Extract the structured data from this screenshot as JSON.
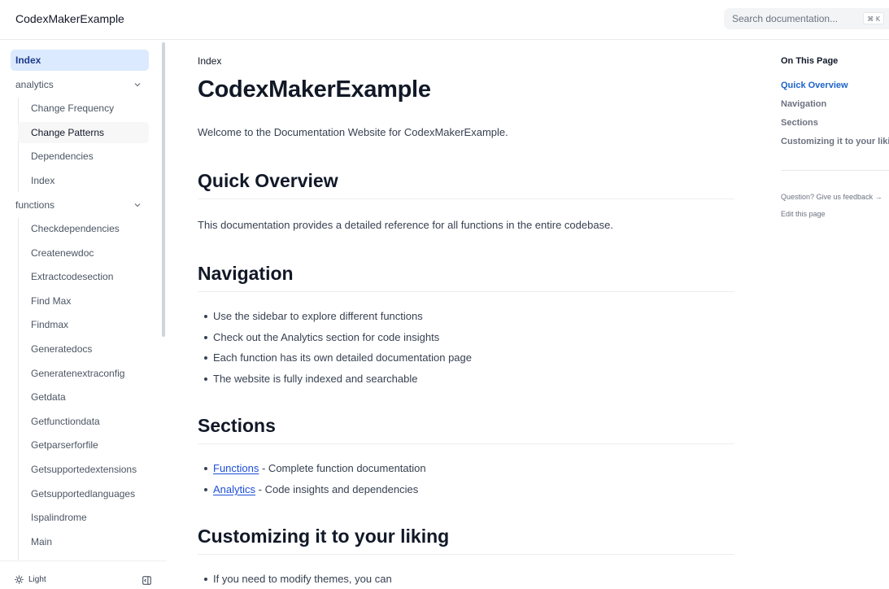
{
  "header": {
    "logo": "CodexMakerExample",
    "search_placeholder": "Search documentation...",
    "search_shortcut": "⌘ K"
  },
  "sidebar": {
    "index": "Index",
    "groups": [
      {
        "label": "analytics",
        "items": [
          "Change Frequency",
          "Change Patterns",
          "Dependencies",
          "Index"
        ]
      },
      {
        "label": "functions",
        "items": [
          "Checkdependencies",
          "Createnewdoc",
          "Extractcodesection",
          "Find Max",
          "Findmax",
          "Generatedocs",
          "Generatenextraconfig",
          "Getdata",
          "Getfunctiondata",
          "Getparserforfile",
          "Getsupportedextensions",
          "Getsupportedlanguages",
          "Ispalindrome",
          "Main"
        ]
      }
    ],
    "theme_label": "Light"
  },
  "main": {
    "breadcrumb": "Index",
    "title": "CodexMakerExample",
    "intro": "Welcome to the Documentation Website for CodexMakerExample.",
    "quick_overview": {
      "heading": "Quick Overview",
      "text": "This documentation provides a detailed reference for all functions in the entire codebase."
    },
    "navigation": {
      "heading": "Navigation",
      "items": [
        "Use the sidebar to explore different functions",
        "Check out the Analytics section for code insights",
        "Each function has its own detailed documentation page",
        "The website is fully indexed and searchable"
      ]
    },
    "sections": {
      "heading": "Sections",
      "items": [
        {
          "link": "Functions",
          "text": " - Complete function documentation"
        },
        {
          "link": "Analytics",
          "text": " - Code insights and dependencies"
        }
      ]
    },
    "customizing": {
      "heading": "Customizing it to your liking",
      "items": [
        "If you need to modify themes, you can"
      ]
    }
  },
  "toc": {
    "title": "On This Page",
    "links": [
      "Quick Overview",
      "Navigation",
      "Sections",
      "Customizing it to your liking"
    ],
    "feedback": "Question? Give us feedback →",
    "edit": "Edit this page"
  },
  "colors": {
    "accent": "#1d63c7",
    "active_bg": "#dbeafe",
    "link": "#1d4ed8"
  }
}
